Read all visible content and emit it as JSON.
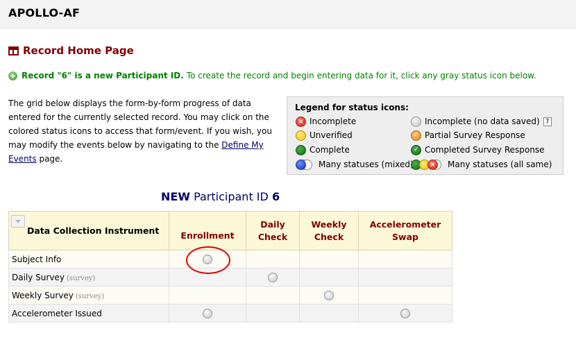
{
  "app": {
    "title": "APOLLO-AF"
  },
  "page": {
    "title": "Record Home Page"
  },
  "notice": {
    "strong": "Record \"6\" is a new Participant ID.",
    "text": "To create the record and begin entering data for it, click any gray status icon below."
  },
  "description": {
    "text": "The grid below displays the form-by-form progress of data entered for the currently selected record. You may click on the colored status icons to access that form/event. If you wish, you may modify the events below by navigating to the ",
    "link": "Define My Events",
    "suffix": " page."
  },
  "legend": {
    "title": "Legend for status icons:",
    "items": [
      {
        "icon": "red",
        "label": "Incomplete"
      },
      {
        "icon": "gray",
        "label": "Incomplete (no data saved)",
        "help": "?"
      },
      {
        "icon": "yellow",
        "label": "Unverified"
      },
      {
        "icon": "orange-check",
        "label": "Partial Survey Response"
      },
      {
        "icon": "green",
        "label": "Complete"
      },
      {
        "icon": "green-check",
        "label": "Completed Survey Response"
      },
      {
        "icon": "blue-stack",
        "label": "Many statuses (mixed)"
      },
      {
        "icon": "multi-stack",
        "label": "Many statuses (all same)"
      }
    ]
  },
  "grid": {
    "heading_new": "NEW",
    "heading_label": "Participant ID",
    "heading_id": "6",
    "instrument_header": "Data Collection Instrument",
    "events": [
      {
        "line1": "Enrollment",
        "line2": ""
      },
      {
        "line1": "Daily",
        "line2": "Check"
      },
      {
        "line1": "Weekly",
        "line2": "Check"
      },
      {
        "line1": "Accelerometer",
        "line2": "Swap"
      }
    ],
    "rows": [
      {
        "name": "Subject Info",
        "tag": "",
        "cells": [
          true,
          false,
          false,
          false
        ]
      },
      {
        "name": "Daily Survey",
        "tag": "(survey)",
        "cells": [
          false,
          true,
          false,
          false
        ]
      },
      {
        "name": "Weekly Survey",
        "tag": "(survey)",
        "cells": [
          false,
          false,
          true,
          false
        ]
      },
      {
        "name": "Accelerometer Issued",
        "tag": "",
        "cells": [
          true,
          false,
          false,
          true
        ]
      }
    ]
  },
  "colors": {
    "title_red": "#800000",
    "notice_green": "#008000",
    "heading_navy": "#000066",
    "annotation_red": "#e00000"
  }
}
